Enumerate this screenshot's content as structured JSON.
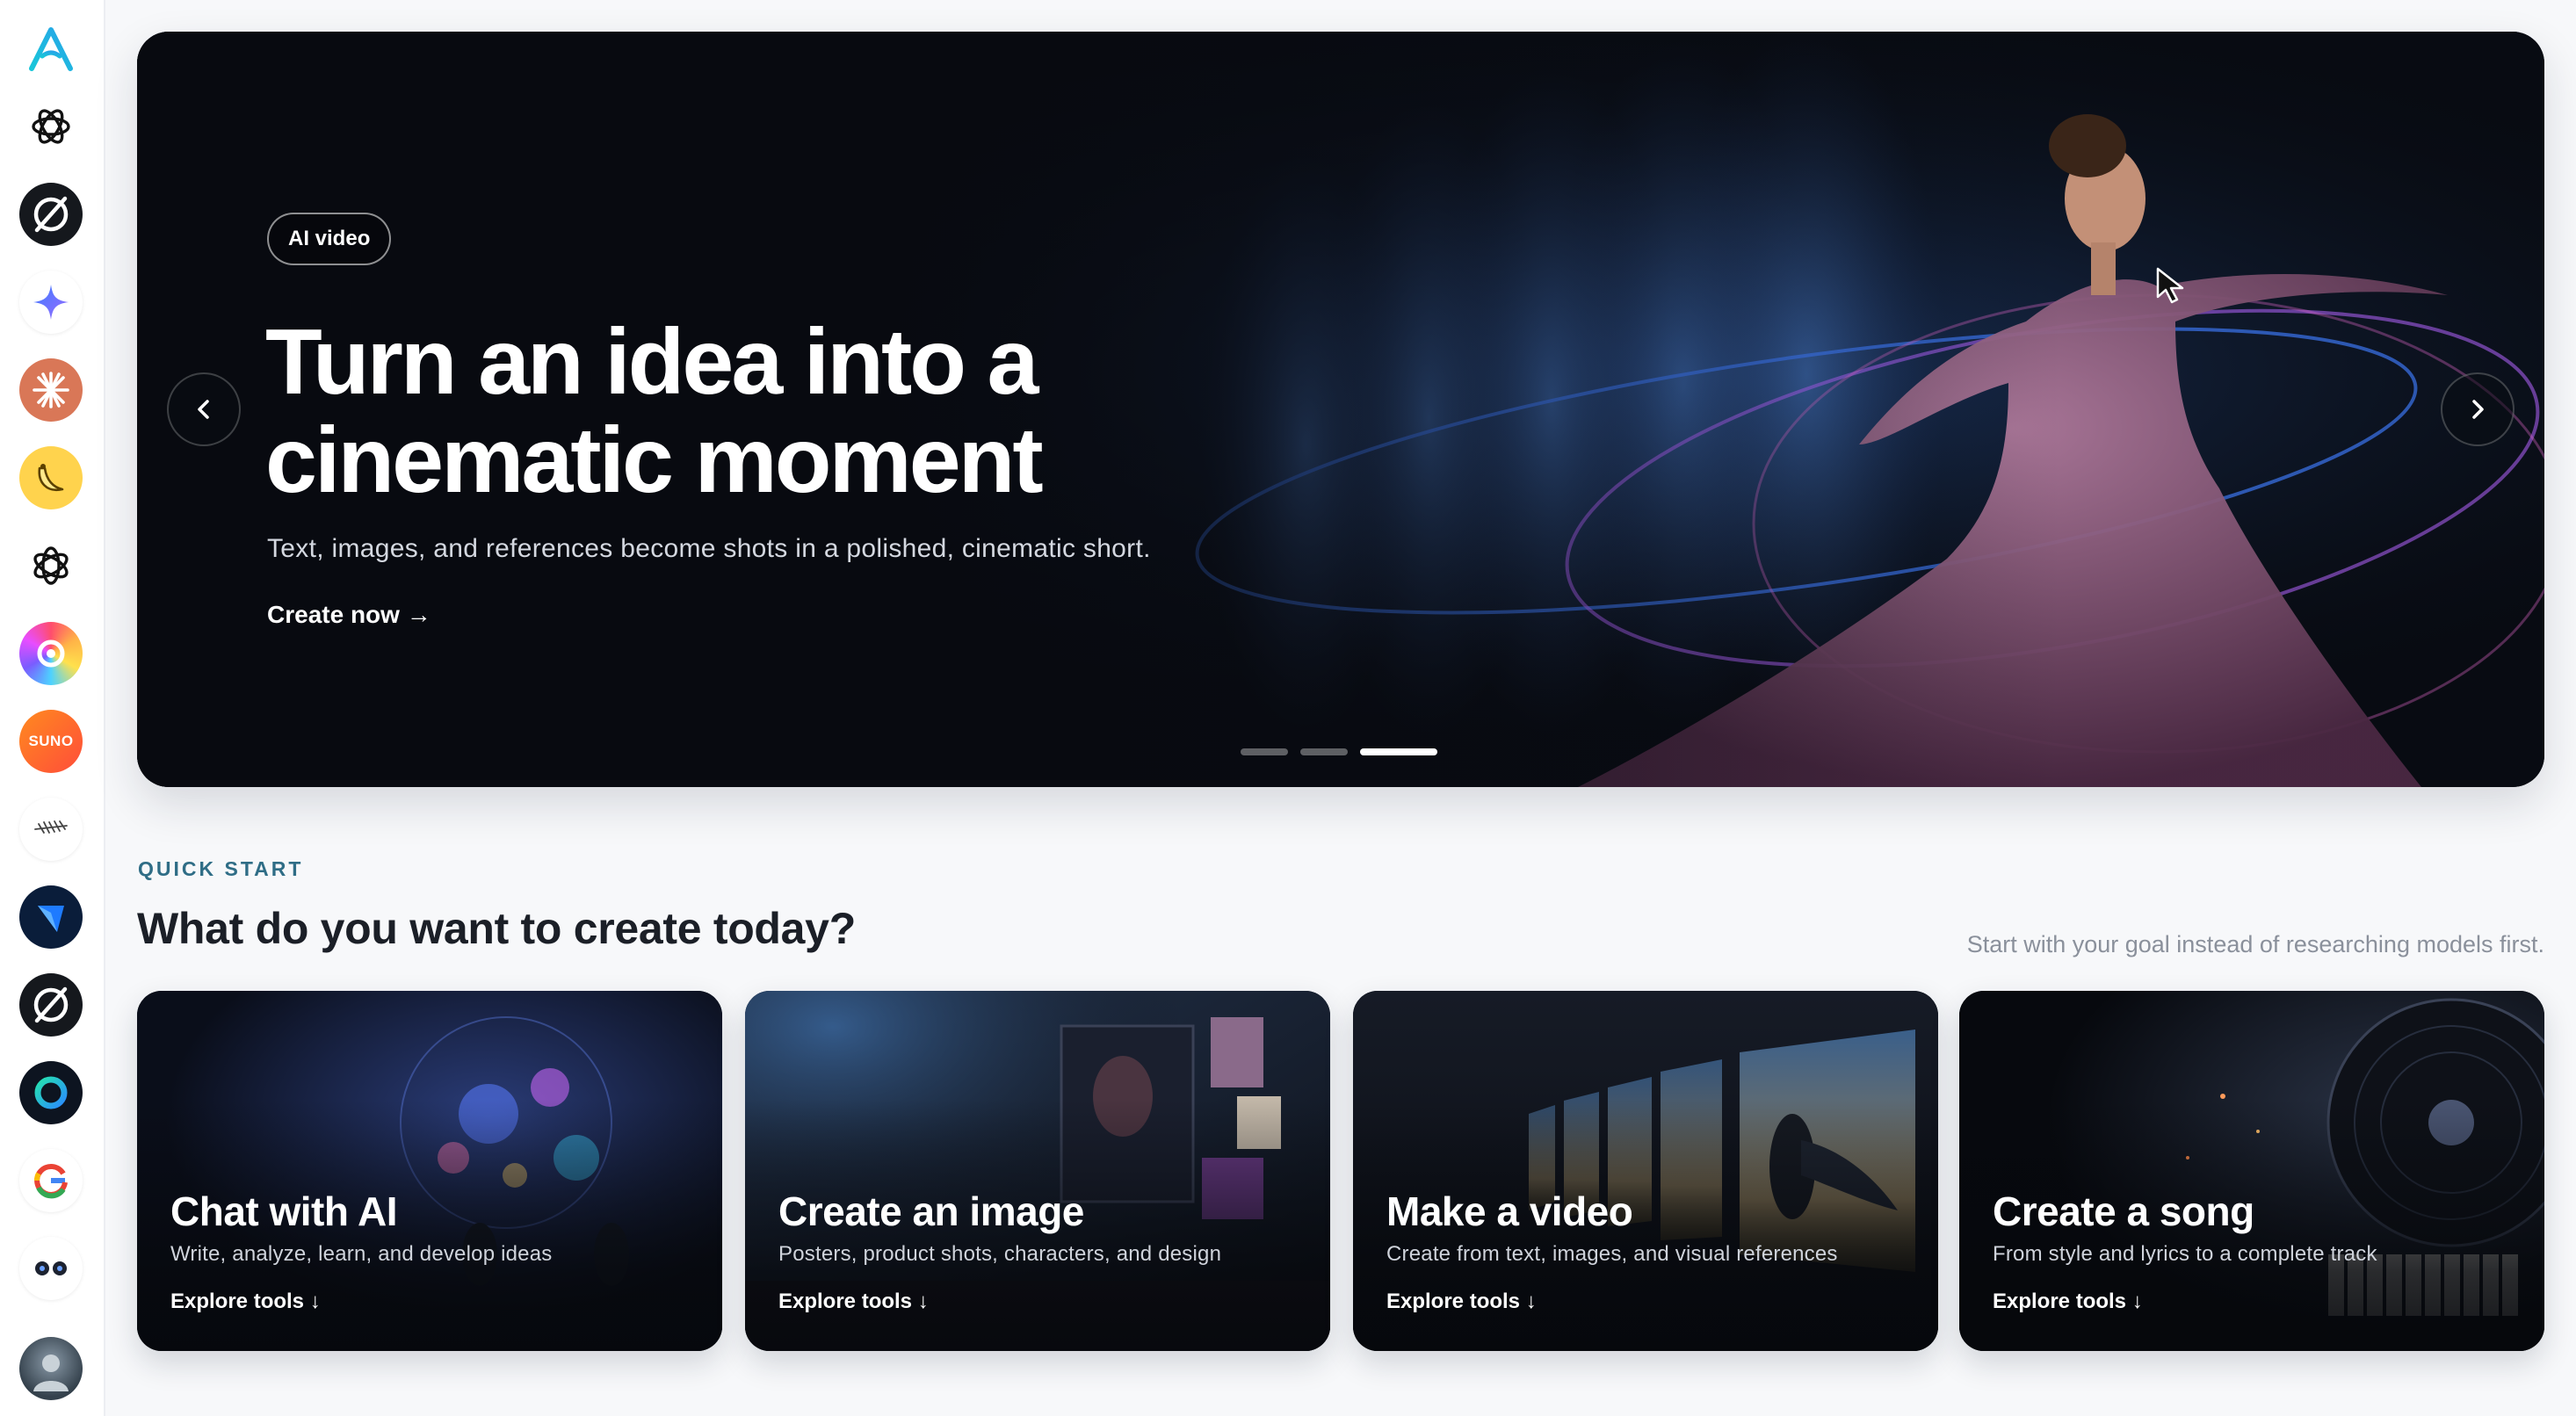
{
  "sidebar": {
    "logo": "app-logo-icon",
    "items": [
      {
        "icon": "chatgpt-icon"
      },
      {
        "icon": "slashed-circle-icon"
      },
      {
        "icon": "gemini-sparkle-icon"
      },
      {
        "icon": "claude-burst-icon"
      },
      {
        "icon": "banana-icon"
      },
      {
        "icon": "openai-knot-icon"
      },
      {
        "icon": "rainbow-swirl-icon"
      },
      {
        "icon": "suno-icon",
        "text": "SUNO"
      },
      {
        "icon": "feather-icon"
      },
      {
        "icon": "blue-gem-icon"
      },
      {
        "icon": "slashed-circle-icon"
      },
      {
        "icon": "ring-icon"
      },
      {
        "icon": "google-icon"
      },
      {
        "icon": "dual-dots-icon"
      }
    ],
    "avatar": "user-avatar"
  },
  "hero": {
    "badge": "AI video",
    "title_line1": "Turn an idea into a",
    "title_line2": "cinematic moment",
    "subtitle": "Text, images, and references become shots in a polished, cinematic short.",
    "cta": "Create now →",
    "prev_icon": "chevron-left-icon",
    "next_icon": "chevron-right-icon",
    "slides_total": 3,
    "active_slide": 3
  },
  "quick_start": {
    "label": "QUICK START",
    "heading": "What do you want to create today?",
    "hint": "Start with your goal instead of researching models first.",
    "cards": [
      {
        "title": "Chat with AI",
        "desc": "Write, analyze, learn, and develop ideas",
        "link": "Explore tools ↓"
      },
      {
        "title": "Create an image",
        "desc": "Posters, product shots, characters, and design",
        "link": "Explore tools ↓"
      },
      {
        "title": "Make a video",
        "desc": "Create from text, images, and visual references",
        "link": "Explore tools ↓"
      },
      {
        "title": "Create a song",
        "desc": "From style and lyrics to a complete track",
        "link": "Explore tools ↓"
      }
    ]
  },
  "colors": {
    "accent_label": "#2f6d86",
    "hero_bg": "#0a0d14",
    "page_bg": "#f7f8fa"
  }
}
